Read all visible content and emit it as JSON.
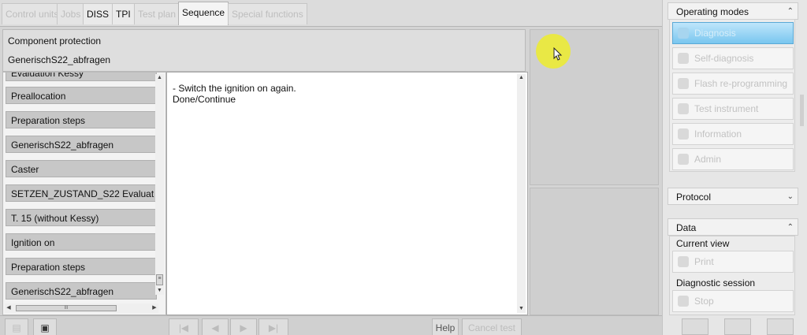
{
  "tabs": [
    "Control units",
    "Jobs",
    "DISS",
    "TPI",
    "Test plan",
    "Sequence",
    "Special functions"
  ],
  "header": {
    "line1": "Component protection",
    "line2": "GenerischS22_abfragen"
  },
  "list": {
    "partial_top": "Evaluation Kessy",
    "items": [
      "Preallocation",
      "Preparation steps",
      "GenerischS22_abfragen",
      "Caster",
      "SETZEN_ZUSTAND_S22 Evaluat",
      "T. 15 (without Kessy)",
      "Ignition on",
      "Preparation steps",
      "GenerischS22_abfragen"
    ]
  },
  "textarea": {
    "line1": "- Switch the ignition on again.",
    "line2": "Done/Continue"
  },
  "bottombar": {
    "help": "Help",
    "cancel_test": "Cancel test"
  },
  "right": {
    "operating_modes": "Operating modes",
    "modes": [
      "Diagnosis",
      "Self-diagnosis",
      "Flash re-programming",
      "Test instrument",
      "Information",
      "Admin"
    ],
    "protocol": "Protocol",
    "data": "Data",
    "current_view": "Current view",
    "print": "Print",
    "diagnostic_session": "Diagnostic session",
    "stop": "Stop"
  },
  "colors": {
    "active_mode": "#79c6ef",
    "cursor_highlight": "#ecea3a"
  }
}
